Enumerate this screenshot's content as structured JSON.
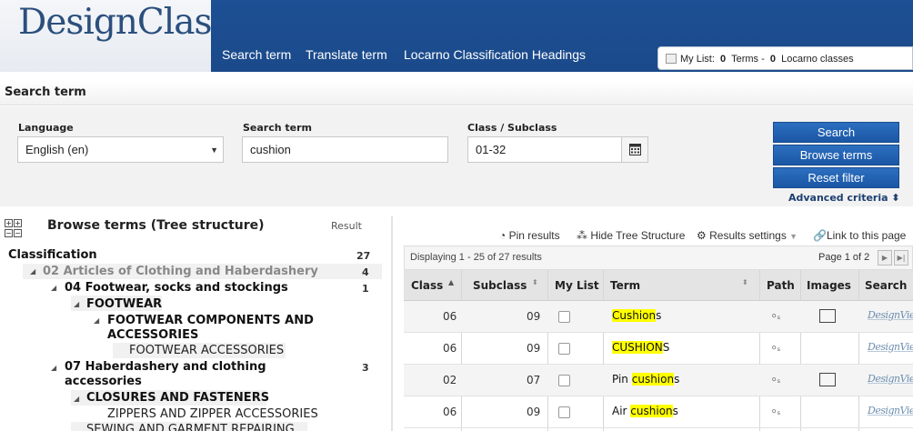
{
  "header": {
    "logo": "DesignClass",
    "nav": [
      "Search term",
      "Translate term",
      "Locarno Classification Headings"
    ],
    "mylist": {
      "label": "My List:",
      "terms_count": "0",
      "terms_label": "Terms -",
      "classes_count": "0",
      "classes_label": "Locarno classes"
    }
  },
  "search": {
    "section_title": "Search term",
    "language_label": "Language",
    "language_value": "English (en)",
    "term_label": "Search term",
    "term_value": "cushion",
    "class_label": "Class / Subclass",
    "class_value": "01-32",
    "search_button": "Search",
    "browse_button": "Browse terms",
    "reset_button": "Reset filter",
    "advanced": "Advanced criteria"
  },
  "tree": {
    "title": "Browse terms (Tree structure)",
    "result_label": "Result",
    "root": {
      "label": "Classification",
      "count": "27"
    },
    "nodes": [
      {
        "label": "02 Articles of Clothing and Haberdashery",
        "count": "4"
      },
      {
        "label": "04 Footwear, socks and stockings",
        "count": "1"
      },
      {
        "label": "FOOTWEAR"
      },
      {
        "label": "FOOTWEAR COMPONENTS AND",
        "label2": "ACCESSORIES"
      },
      {
        "label": "FOOTWEAR ACCESSORIES"
      },
      {
        "label": "07 Haberdashery and clothing",
        "label2": "accessories",
        "count": "3"
      },
      {
        "label": "CLOSURES AND FASTENERS"
      },
      {
        "label": "ZIPPERS AND ZIPPER ACCESSORIES"
      },
      {
        "label": "SEWING AND GARMENT REPAIRING"
      }
    ]
  },
  "results": {
    "toolbar": [
      "Pin results",
      "Hide Tree Structure",
      "Results settings",
      "Link to this page"
    ],
    "displaying": "Displaying 1 - 25 of 27 results",
    "page": "Page 1 of 2",
    "columns": [
      "Class",
      "Subclass",
      "My List",
      "Term",
      "Path",
      "Images",
      "Search"
    ],
    "rows": [
      {
        "class": "06",
        "subclass": "09",
        "term_pre": "",
        "term_hl": "Cushion",
        "term_post": "s",
        "has_image": true,
        "search": "DesignView"
      },
      {
        "class": "06",
        "subclass": "09",
        "term_pre": "",
        "term_hl": "CUSHION",
        "term_post": "S",
        "has_image": false,
        "search": "DesignView"
      },
      {
        "class": "02",
        "subclass": "07",
        "term_pre": "Pin ",
        "term_hl": "cushion",
        "term_post": "s",
        "has_image": true,
        "search": "DesignView"
      },
      {
        "class": "06",
        "subclass": "09",
        "term_pre": "Air ",
        "term_hl": "cushion",
        "term_post": "s",
        "has_image": false,
        "search": "DesignView"
      }
    ]
  }
}
